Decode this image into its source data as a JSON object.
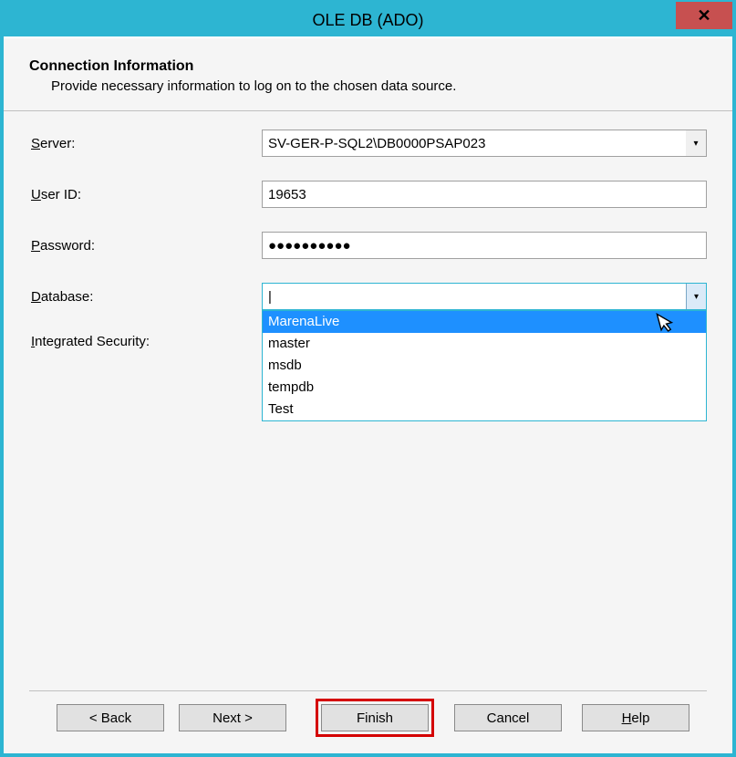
{
  "window": {
    "title": "OLE DB (ADO)",
    "close_glyph": "✕"
  },
  "header": {
    "title": "Connection Information",
    "subtitle": "Provide necessary information to log on to the chosen data source."
  },
  "labels": {
    "server_pre": "S",
    "server_rest": "erver:",
    "userid_pre": "U",
    "userid_rest": "ser ID:",
    "password_pre": "P",
    "password_rest": "assword:",
    "database_pre": "D",
    "database_rest": "atabase:",
    "integrated_pre": "I",
    "integrated_rest": "ntegrated Security:"
  },
  "values": {
    "server": "SV-GER-P-SQL2\\DB0000PSAP023",
    "user_id": "19653",
    "password_mask": "●●●●●●●●●●",
    "database": "",
    "database_caret": "|"
  },
  "database_options": [
    "MarenaLive",
    "master",
    "msdb",
    "tempdb",
    "Test"
  ],
  "database_selected_index": 0,
  "buttons": {
    "back": "< Back",
    "next": "Next >",
    "finish": "Finish",
    "cancel": "Cancel",
    "help_pre": "H",
    "help_rest": "elp"
  }
}
